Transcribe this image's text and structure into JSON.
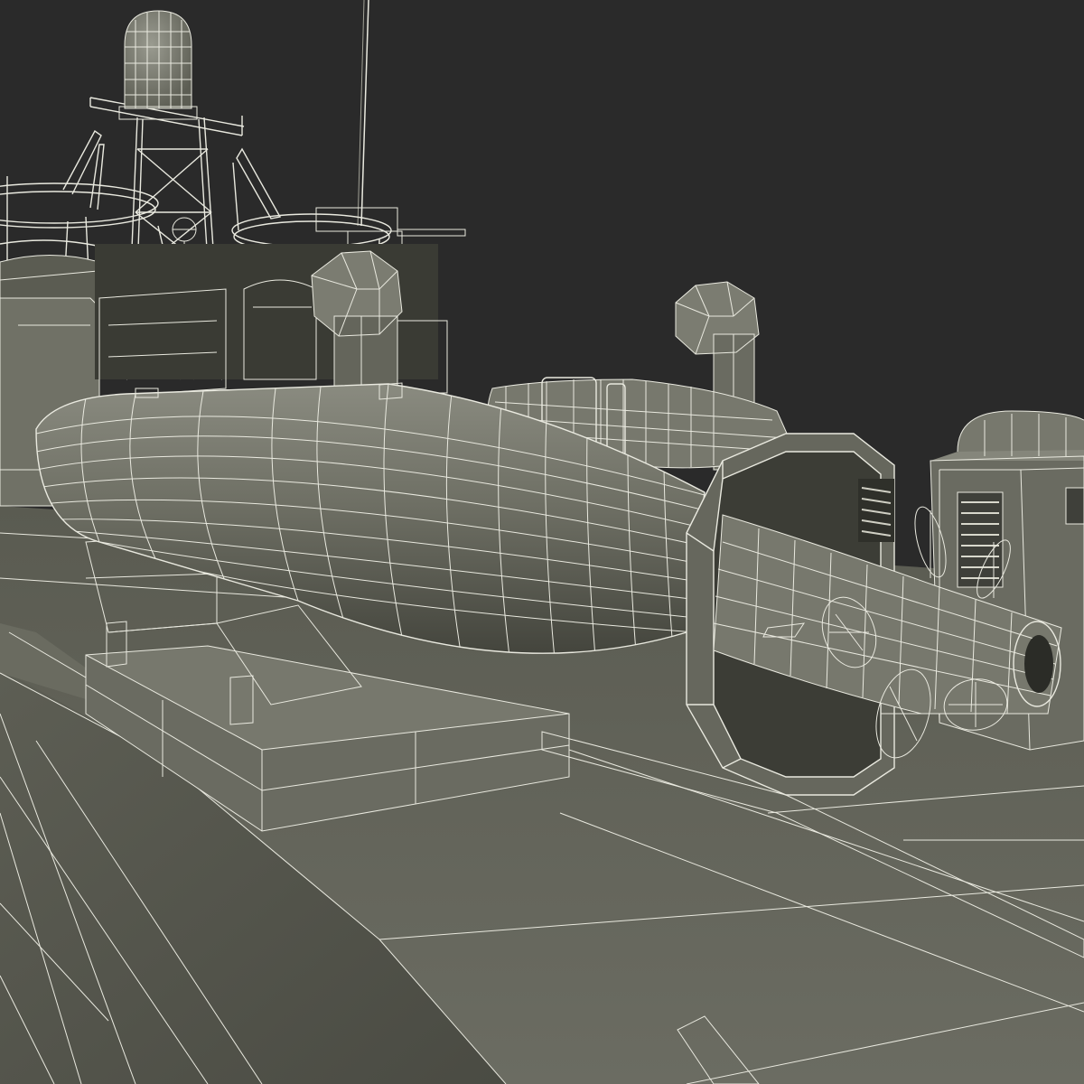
{
  "scene": {
    "background_color": "#2a2a2a",
    "surface_color": "#5b5c52",
    "surface_light_color": "#7a7b70",
    "wire_color": "#e9e9df",
    "objects": [
      "radar-dome",
      "lattice-mast",
      "antenna",
      "railing",
      "deck-gun",
      "ventilator-cowl",
      "bridge-housing",
      "torpedo",
      "torpedo-cradle",
      "propellers",
      "rear-torpedo",
      "cabinet-with-louvers",
      "deck"
    ]
  }
}
